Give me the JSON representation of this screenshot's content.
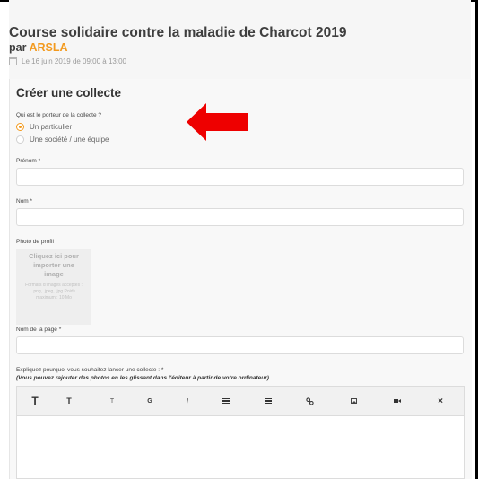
{
  "event": {
    "title": "Course solidaire contre la maladie de Charcot 2019",
    "by_prefix": "par",
    "organizer": "ARSLA",
    "date": "Le 16 juin 2019 de 09:00 à 13:00"
  },
  "form": {
    "title": "Créer une collecte",
    "carrier_question": "Qui est le porteur de la collecte ?",
    "carrier_options": [
      {
        "label": "Un particulier",
        "selected": true
      },
      {
        "label": "Une société / une équipe",
        "selected": false
      }
    ],
    "firstname": {
      "label": "Prénom *",
      "value": ""
    },
    "lastname": {
      "label": "Nom *",
      "value": ""
    },
    "photo": {
      "label": "Photo de profil",
      "cta": "Cliquez ici pour importer une image",
      "help": "Formats d'images acceptés : .png, .jpeg, .jpg Poids maximum : 10 Mo"
    },
    "page_name": {
      "label": "Nom de la page *",
      "value": ""
    },
    "explain": {
      "label": "Expliquez pourquoi vous souhaitez lancer une collecte : *",
      "hint": "(Vous pouvez rajouter des photos en les glissant dans l'éditeur à partir de votre ordinateur)"
    }
  },
  "editor_toolbar": {
    "heading1": "T",
    "heading2": "T",
    "heading3": "T",
    "bold": "G",
    "italic": "I",
    "icons": [
      "ordered-list-icon",
      "unordered-list-icon",
      "link-icon",
      "image-icon",
      "video-icon",
      "close-icon"
    ]
  },
  "annotation": {
    "arrow_color": "#ee0000"
  },
  "colors": {
    "accent": "#f39a1e"
  }
}
